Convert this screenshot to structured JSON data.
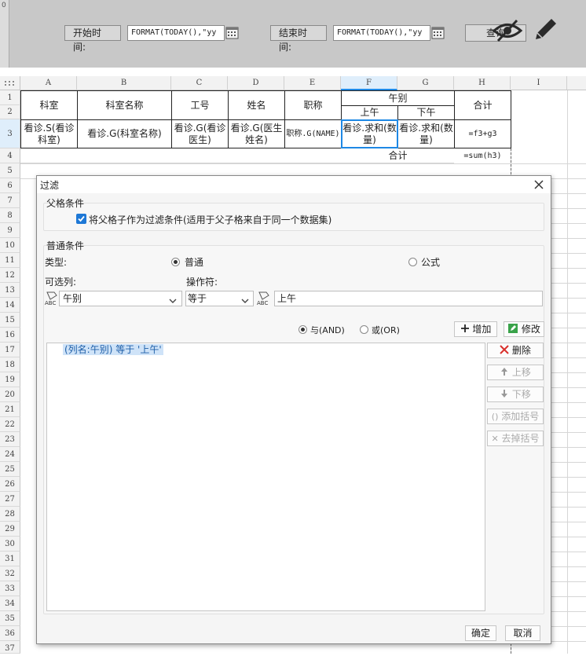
{
  "param_bar": {
    "row_label": "0",
    "start_label": "开始时间:",
    "start_value": "FORMAT(TODAY(),\"yy",
    "end_label": "结束时间:",
    "end_value": "FORMAT(TODAY(),\"yy",
    "query_label": "查询"
  },
  "sheet": {
    "columns": [
      "A",
      "B",
      "C",
      "D",
      "E",
      "F",
      "G",
      "H",
      "I"
    ],
    "rows": [
      "1",
      "2",
      "3",
      "4",
      "5",
      "6",
      "7",
      "8",
      "9",
      "10",
      "11",
      "12",
      "13",
      "14",
      "15",
      "16",
      "17",
      "18",
      "19",
      "20",
      "21",
      "22",
      "23",
      "24",
      "25",
      "26",
      "27",
      "28",
      "29",
      "30",
      "31",
      "32",
      "33",
      "34",
      "35",
      "36",
      "37"
    ],
    "headers": {
      "ks": "科室",
      "ksmc": "科室名称",
      "gh": "工号",
      "xm": "姓名",
      "zc": "职称",
      "wb": "午别",
      "sw": "上午",
      "xw": "下午",
      "hj": "合计"
    },
    "row3": {
      "a": "看诊.S(看诊科室)",
      "b": "看诊.G(科室名称)",
      "c": "看诊.G(看诊医生)",
      "d": "看诊.G(医生姓名)",
      "e": "职称.G(NAME)",
      "f": "看诊.求和(数量)",
      "g": "看诊.求和(数量)",
      "h": "=f3+g3"
    },
    "row4": {
      "g": "合计",
      "h": "=sum(h3)"
    }
  },
  "dialog": {
    "title": "过滤",
    "parent_section": "父格条件",
    "parent_checkbox": "将父格子作为过滤条件(适用于父子格来自于同一个数据集)",
    "normal_section": "普通条件",
    "type_label": "类型:",
    "type_normal": "普通",
    "type_formula": "公式",
    "column_label": "可选列:",
    "operator_label": "操作符:",
    "column_value": "午别",
    "operator_value": "等于",
    "value_input": "上午",
    "and_label": "与(AND)",
    "or_label": "或(OR)",
    "add_label": "增加",
    "modify_label": "修改",
    "condition_item": "(列名:午别) 等于 '上午'",
    "delete_label": "删除",
    "move_up_label": "上移",
    "move_down_label": "下移",
    "add_bracket_label": "添加括号",
    "remove_bracket_label": "去掉括号",
    "ok_label": "确定",
    "cancel_label": "取消"
  },
  "colors": {
    "selection_blue": "#1e88e5",
    "highlight_bg": "#cfe3f8",
    "check_blue": "#1e78d6"
  },
  "icons": [
    "calendar-icon",
    "eye-off-icon",
    "pencil-icon",
    "close-icon",
    "checkbox-checked-icon",
    "column-abc-icon",
    "chevron-down-icon",
    "plus-icon",
    "edit-icon",
    "delete-x-icon",
    "arrow-up-icon",
    "arrow-down-icon",
    "add-bracket-icon",
    "remove-bracket-icon"
  ]
}
